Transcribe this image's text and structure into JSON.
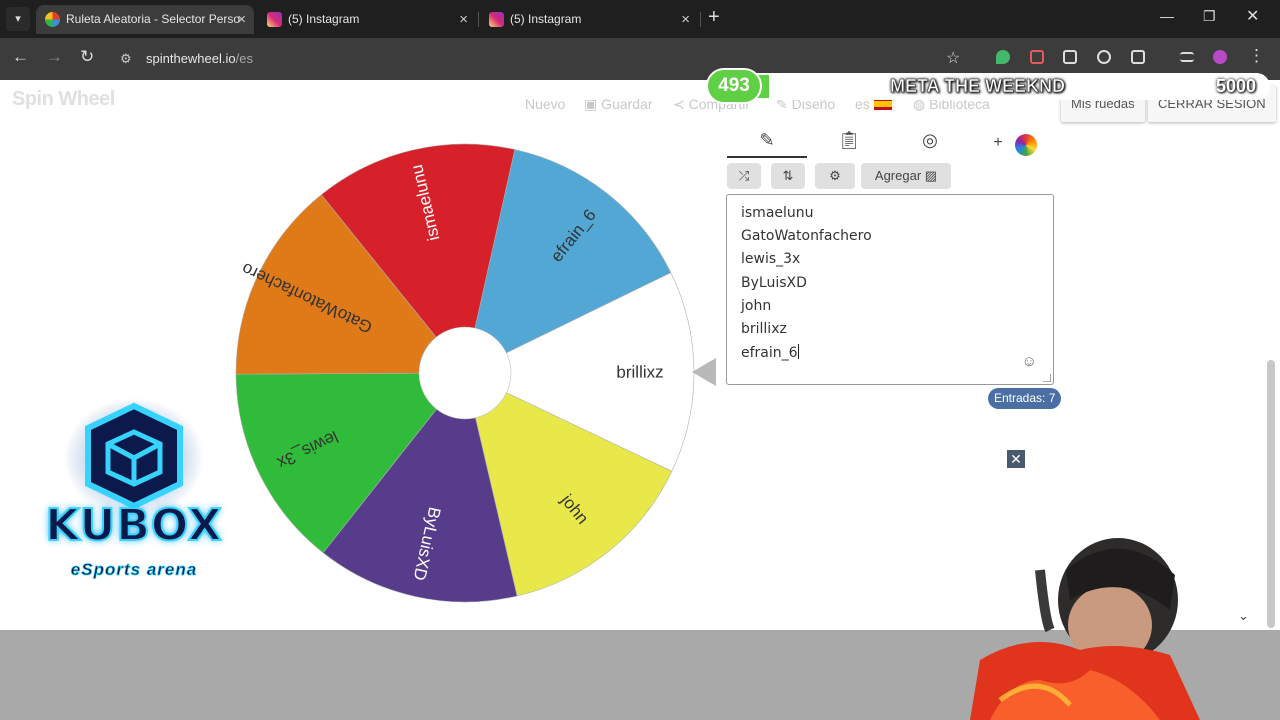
{
  "browser": {
    "tabs": [
      {
        "title": "Ruleta Aleatoria - Selector Perso",
        "active": true,
        "icon": "wheel-favicon"
      },
      {
        "title": "(5) Instagram",
        "active": false,
        "icon": "instagram-favicon"
      },
      {
        "title": "(5) Instagram",
        "active": false,
        "icon": "instagram-favicon"
      }
    ],
    "url_domain": "spinthewheel.io",
    "url_path": "/es"
  },
  "site": {
    "logo": "Spin Wheel",
    "nav": {
      "new": "Nuevo",
      "save": "Guardar",
      "share": "Compartir",
      "design": "Diseño",
      "lang": "es",
      "library": "Biblioteca",
      "my_wheels": "Mis ruedas",
      "logout": "CERRAR SESIÓN"
    }
  },
  "goal": {
    "current": "493",
    "title": "META THE WEEKND",
    "target": "5000",
    "progress": 0.0986
  },
  "wheel": {
    "center_color": "#ffffff",
    "segments": [
      {
        "label": "brillixz",
        "color": "#ffffff",
        "text_color": "#333333"
      },
      {
        "label": "john",
        "color": "#e8e84a",
        "text_color": "#333333"
      },
      {
        "label": "ByLuisXD",
        "color": "#583c8c",
        "text_color": "#ffffff"
      },
      {
        "label": "lewis_3x",
        "color": "#31bb3a",
        "text_color": "#333333"
      },
      {
        "label": "GatoWatonfachero",
        "color": "#e07a18",
        "text_color": "#333333"
      },
      {
        "label": "ismaelunu",
        "color": "#d6202a",
        "text_color": "#ffffff"
      },
      {
        "label": "efrain_6",
        "color": "#53a7d5",
        "text_color": "#333333"
      }
    ]
  },
  "editor": {
    "tabs": [
      "edit-entries",
      "results",
      "hidden",
      "add-color"
    ],
    "add_image_label": "Agregar",
    "entries": [
      "ismaelunu",
      "GatoWatonfachero",
      "lewis_3x",
      "ByLuisXD",
      "john",
      "brillixz",
      "efrain_6"
    ],
    "count_label": "Entradas: 7"
  },
  "overlay": {
    "logo_title": "KUBOX",
    "logo_subtitle": "eSports arena"
  }
}
